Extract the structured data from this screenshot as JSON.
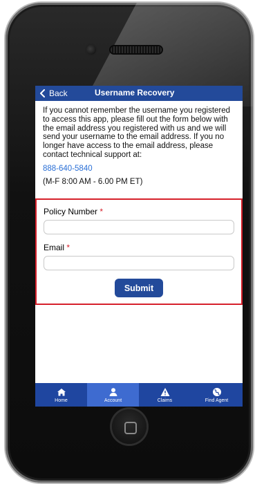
{
  "header": {
    "back_label": "Back",
    "title": "Username Recovery"
  },
  "content": {
    "intro": "If you cannot remember the username you registered to access this app, please fill out the form below with the email address you registered with us and we will send your username to the email address. If you no longer have access to the email address, please contact technical support at:",
    "phone": "888-640-5840",
    "hours": "(M-F 8:00 AM - 6.00 PM ET)"
  },
  "form": {
    "policy_label": "Policy Number",
    "email_label": "Email",
    "required_marker": "*",
    "policy_value": "",
    "email_value": "",
    "submit_label": "Submit"
  },
  "tabs": [
    {
      "label": "Home",
      "icon": "home-icon",
      "active": false
    },
    {
      "label": "Account",
      "icon": "user-icon",
      "active": true
    },
    {
      "label": "Claims",
      "icon": "warning-icon",
      "active": false
    },
    {
      "label": "Find Agent",
      "icon": "globe-icon",
      "active": false
    }
  ],
  "colors": {
    "primary": "#234a9a",
    "tab_active": "#3e6bd0",
    "required": "#d61f2a",
    "link": "#2a6fd6"
  }
}
